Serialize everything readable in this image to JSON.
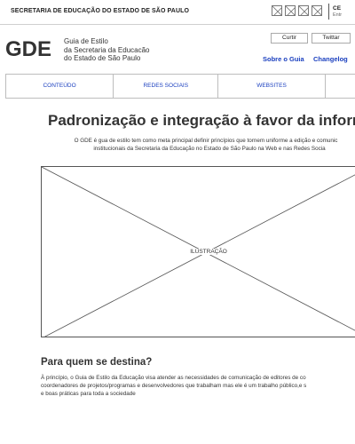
{
  "topbar": {
    "secretaria": "SECRETARIA DE EDUCAÇÃO DO ESTADO DE SÃO PAULO",
    "cut_title": "CE",
    "cut_sub": "Entr"
  },
  "header": {
    "logo": "GDE",
    "desc_line1": "Guia de Estilo",
    "desc_line2": "da Secretaria da Educacão",
    "desc_line3": "do Estado de São Paulo",
    "curtir": "Curtir",
    "twittar": "Twittar",
    "sobre": "Sobre o Guia",
    "changelog": "Changelog"
  },
  "menu": {
    "items": [
      "CONTEÚDO",
      "REDES SOCIAIS",
      "WEBSITES",
      ""
    ]
  },
  "main": {
    "headline": "Padronização e integração à favor da inform",
    "intro_line1": "O GDE é gua de estilo tem como meta principal definir princípios que tornem uniforme a edição e comunic",
    "intro_line2": "institucionais da Secretaria da Educação no Estado de São Paulo na Web e nas Redes Socia",
    "illustration_label": "ILUSTRAÇÃO",
    "section_title": "Para quem se destina?",
    "section_line1": "À princípio,  o Guia de Estilo da Educação visa atender as necessidades de comunicação de editores de co",
    "section_line2": "coordenadores de projetos/programas e desenvolvedores que trabalham mas ele é um trabalho público,e s",
    "section_line3": "e boas práticas para toda a sociedade"
  },
  "colors": {
    "link": "#1a3fbf",
    "border": "#bdbdbd",
    "text": "#333333"
  }
}
